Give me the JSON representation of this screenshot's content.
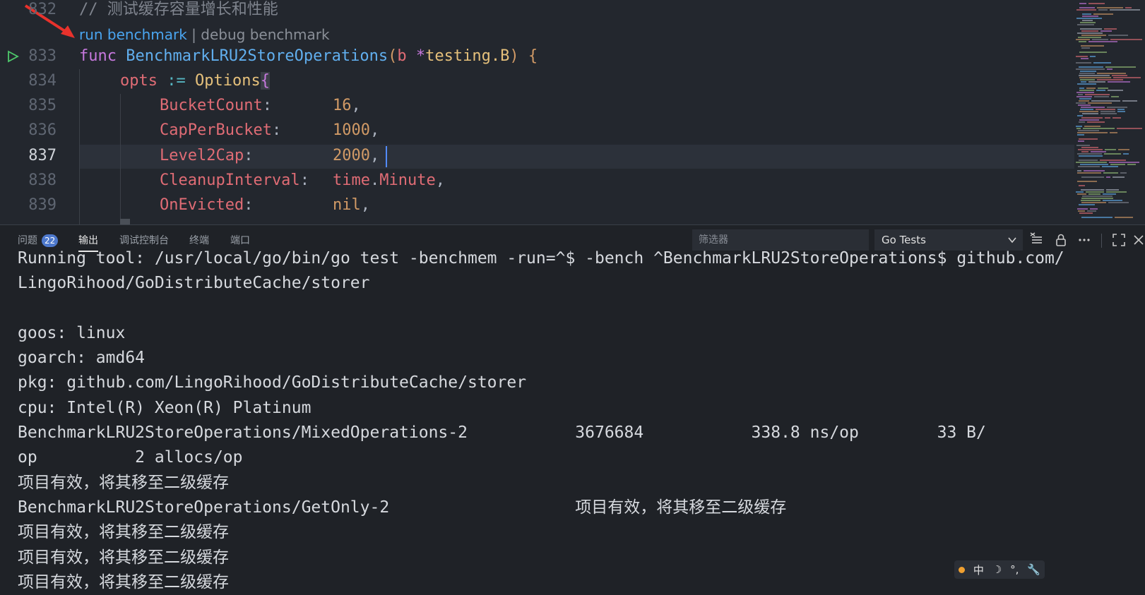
{
  "editor": {
    "comment_line": {
      "number": "832",
      "text": "// 测试缓存容量增长和性能"
    },
    "codelens": {
      "run": "run benchmark",
      "separator": " | ",
      "debug": "debug benchmark"
    },
    "lines": [
      {
        "number": "833"
      },
      {
        "number": "834"
      },
      {
        "number": "835"
      },
      {
        "number": "836"
      },
      {
        "number": "837"
      },
      {
        "number": "838"
      },
      {
        "number": "839"
      }
    ],
    "tokens": {
      "func_kw": "func",
      "func_name": "BenchmarkLRU2StoreOperations",
      "open_paren": "(",
      "param": "b",
      "star": " *",
      "param_type": "testing.B",
      "close_paren": ") ",
      "open_brace": "{",
      "opts": "opts",
      "assign": " := ",
      "options_type": "Options",
      "options_brace": "{",
      "f1": "BucketCount",
      "c1": ":",
      "v1": "16",
      "p1": ",",
      "f2": "CapPerBucket",
      "c2": ":",
      "v2": "1000",
      "p2": ",",
      "f3": "Level2Cap",
      "c3": ":",
      "v3": "2000",
      "p3": ",",
      "f4": "CleanupInterval",
      "c4": ":",
      "v4a": "time",
      "v4dot": ".",
      "v4b": "Minute",
      "p4": ",",
      "f5": "OnEvicted",
      "c5": ":",
      "v5": "nil",
      "p5": ","
    }
  },
  "panel": {
    "tabs": [
      {
        "label": "问题",
        "badge": "22"
      },
      {
        "label": "输出"
      },
      {
        "label": "调试控制台"
      },
      {
        "label": "终端"
      },
      {
        "label": "端口"
      }
    ],
    "filter_placeholder": "筛选器",
    "output_channel": "Go Tests",
    "output_lines": [
      "Running tool: /usr/local/go/bin/go test -benchmem -run=^$ -bench ^BenchmarkLRU2StoreOperations$ github.com/",
      "LingoRihood/GoDistributeCache/storer",
      "",
      "goos: linux",
      "goarch: amd64",
      "pkg: github.com/LingoRihood/GoDistributeCache/storer",
      "cpu: Intel(R) Xeon(R) Platinum",
      "BenchmarkLRU2StoreOperations/MixedOperations-2           3676684           338.8 ns/op        33 B/",
      "op          2 allocs/op",
      "项目有效，将其移至二级缓存",
      "BenchmarkLRU2StoreOperations/GetOnly-2                   项目有效，将其移至二级缓存",
      "项目有效，将其移至二级缓存",
      "项目有效，将其移至二级缓存",
      "项目有效，将其移至二级缓存"
    ]
  },
  "ime": {
    "lang": "中",
    "moon": "☽",
    "punct": "°,",
    "tool": "🔧"
  },
  "colors": {
    "editor_bg": "#23272e",
    "panel_bg": "#1f2227",
    "accent": "#4d78cc",
    "codelens_link": "#4aa5f0"
  }
}
